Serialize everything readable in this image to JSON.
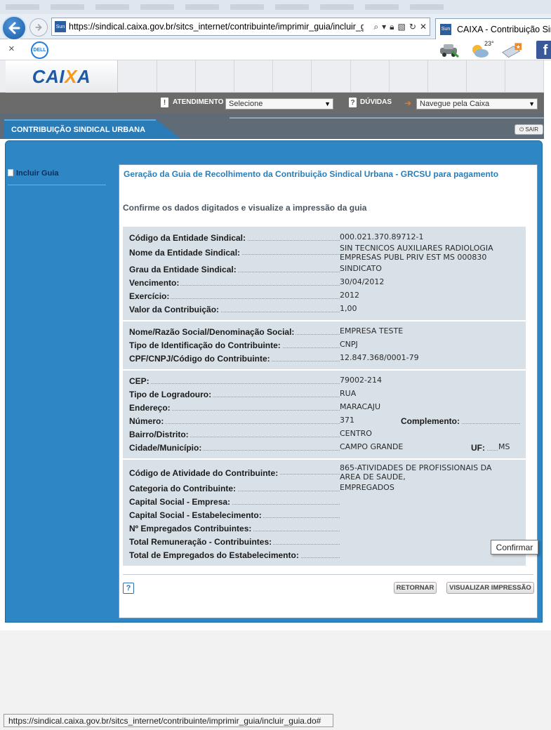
{
  "browser": {
    "url": "https://sindical.caixa.gov.br/sitcs_internet/contribuinte/imprimir_guia/incluir_g",
    "tab_title": "CAIXA - Contribuição Sind",
    "favicon_text": "Sun",
    "temperature": "23°",
    "dell_logo": "DELL",
    "facebook": "f",
    "status_url": "https://sindical.caixa.gov.br/sitcs_internet/contribuinte/imprimir_guia/incluir_guia.do#"
  },
  "header": {
    "logo_part1": "CAI",
    "logo_x": "X",
    "logo_part2": "A",
    "atendimento_label": "ATENDIMENTO",
    "atendimento_selected": "Selecione",
    "duvidas_label": "DÚVIDAS",
    "navegue_selected": "Navegue pela Caixa",
    "sair": "SAIR"
  },
  "tabs": {
    "active": "CONTRIBUIÇÃO SINDICAL URBANA"
  },
  "sidebar": {
    "items": [
      {
        "label": "Incluir Guia"
      }
    ]
  },
  "main": {
    "title": "Geração da Guia de Recolhimento da Contribuição Sindical Urbana - GRCSU para pagamento",
    "subtitle": "Confirme os dados digitados e visualize a impressão da guia",
    "entidade": {
      "codigo_label": "Código da Entidade Sindical:",
      "codigo": "000.021.370.89712-1",
      "nome_label": "Nome da Entidade Sindical:",
      "nome_line1": "SIN TECNICOS AUXILIARES RADIOLOGIA",
      "nome_line2": "EMPRESAS PUBL PRIV EST MS 000830",
      "grau_label": "Grau da Entidade Sindical:",
      "grau": "SINDICATO",
      "vencimento_label": "Vencimento:",
      "vencimento": "30/04/2012",
      "exercicio_label": "Exercício:",
      "exercicio": "2012",
      "valor_label": "Valor da Contribuição:",
      "valor": "1,00"
    },
    "contribuinte": {
      "nome_label": "Nome/Razão Social/Denominação Social:",
      "nome": "EMPRESA TESTE",
      "tipo_id_label": "Tipo de Identificação do Contribuinte:",
      "tipo_id": "CNPJ",
      "cpf_label": "CPF/CNPJ/Código do Contribuinte:",
      "cpf": "12.847.368/0001-79"
    },
    "endereco": {
      "cep_label": "CEP:",
      "cep": "79002-214",
      "tipo_log_label": "Tipo de Logradouro:",
      "tipo_log": "RUA",
      "endereco_label": "Endereço:",
      "endereco": "MARACAJU",
      "numero_label": "Número:",
      "numero": "371",
      "complemento_label": "Complemento:",
      "complemento": "",
      "bairro_label": "Bairro/Distrito:",
      "bairro": "CENTRO",
      "cidade_label": "Cidade/Município:",
      "cidade": "CAMPO GRANDE",
      "uf_label": "UF:",
      "uf": "MS"
    },
    "atividade": {
      "codigo_label": "Código de Atividade do Contribuinte:",
      "codigo_line1": "865-ATIVIDADES DE PROFISSIONAIS DA",
      "codigo_line2": "AREA DE SAUDE,",
      "categoria_label": "Categoria do Contribuinte:",
      "categoria": "EMPREGADOS",
      "capital_empresa_label": "Capital Social - Empresa:",
      "capital_estab_label": "Capital Social - Estabelecimento:",
      "empregados_label": "Nº Empregados Contribuintes:",
      "remuneracao_label": "Total Remuneração - Contribuintes:",
      "total_emp_label": "Total de Empregados do Estabelecimento:"
    },
    "help": "?",
    "retornar": "RETORNAR",
    "visualizar": "VISUALIZAR IMPRESSÃO",
    "tooltip": "Confirmar"
  },
  "colors": {
    "brand_blue": "#1f5aa8",
    "brand_orange": "#f39a1e",
    "panel_blue": "#2e87c4",
    "title_blue": "#2a7db8"
  },
  "icons": [
    "back-arrow-icon",
    "forward-arrow-icon",
    "search-icon",
    "lock-icon",
    "refresh-icon",
    "close-icon",
    "car-icon",
    "weather-icon",
    "mail-icon",
    "facebook-icon",
    "help-icon",
    "document-icon"
  ]
}
